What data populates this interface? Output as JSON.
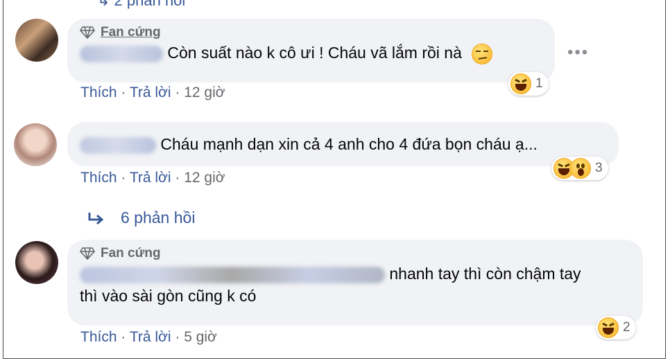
{
  "top_partial_reply": "↳  2 phản hồi",
  "comments": [
    {
      "badge": "Fan cứng",
      "text": "Còn suất nào k cô ưi ! Cháu vã lắm rồi nà",
      "like": "Thích",
      "reply": "Trả lời",
      "sep": "·",
      "time": "12 giờ",
      "reaction_count": "1",
      "reactions": [
        "laughing-emoji"
      ],
      "inline_emoji": "smirk-emoji"
    },
    {
      "badge": "",
      "text": "Cháu mạnh dạn xin cả 4 anh cho 4 đứa bọn cháu ạ...",
      "like": "Thích",
      "reply": "Trả lời",
      "sep": "·",
      "time": "12 giờ",
      "reaction_count": "3",
      "reactions": [
        "laughing-emoji",
        "wow-emoji"
      ]
    },
    {
      "badge": "Fan cứng",
      "text_line1": "nhanh tay thì còn chậm tay",
      "text_line2": "thì vào sài gòn cũng k có",
      "like": "Thích",
      "reply": "Trả lời",
      "sep": "·",
      "time": "5 giờ",
      "reaction_count": "2",
      "reactions": [
        "laughing-emoji"
      ]
    }
  ],
  "replies_link": "6 phản hồi",
  "more_options": "•••",
  "colors": {
    "link": "#385898",
    "bubble": "#f0f2f5",
    "meta": "#65676b"
  }
}
